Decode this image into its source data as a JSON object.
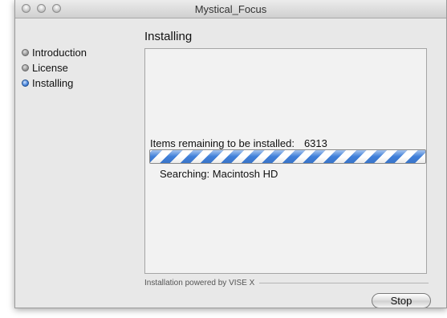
{
  "window": {
    "title": "Mystical_Focus"
  },
  "sidebar": {
    "steps": [
      {
        "label": "Introduction",
        "state": "done"
      },
      {
        "label": "License",
        "state": "done"
      },
      {
        "label": "Installing",
        "state": "active"
      }
    ]
  },
  "main": {
    "section_title": "Installing",
    "remaining_label": "Items remaining to be installed:",
    "remaining_count": "6313",
    "progress": {
      "indeterminate": true,
      "colors": [
        "#3f7fd9",
        "#ffffff"
      ]
    },
    "status_text": "Searching: Macintosh HD"
  },
  "footer": {
    "powered_by": "Installation powered by VISE X",
    "stop_label": "Stop"
  },
  "colors": {
    "window_bg": "#e8e8e8",
    "panel_bg": "#f2f2f2",
    "accent": "#3f7fd9"
  },
  "icons": [
    "step-bullet-icon",
    "step-active-bullet-icon"
  ]
}
